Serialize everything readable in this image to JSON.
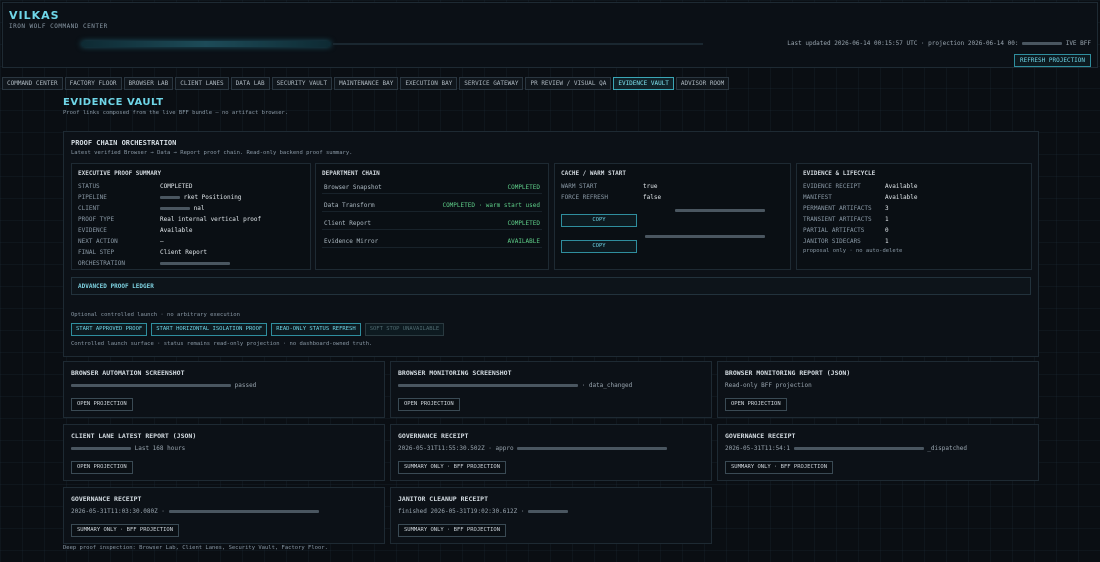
{
  "header": {
    "brand": "VILKAS",
    "subtitle": "IRON WOLF COMMAND CENTER",
    "updated": "Last updated 2026-06-14 00:15:57 UTC · projection 2026-06-14 00:",
    "updated_suffix": "IVE BFF",
    "refresh_label": "REFRESH PROJECTION"
  },
  "tabs": [
    {
      "label": "COMMAND CENTER",
      "active": false
    },
    {
      "label": "FACTORY FLOOR",
      "active": false
    },
    {
      "label": "BROWSER LAB",
      "active": false
    },
    {
      "label": "CLIENT LANES",
      "active": false
    },
    {
      "label": "DATA LAB",
      "active": false
    },
    {
      "label": "SECURITY VAULT",
      "active": false
    },
    {
      "label": "MAINTENANCE BAY",
      "active": false
    },
    {
      "label": "EXECUTION BAY",
      "active": false
    },
    {
      "label": "SERVICE GATEWAY",
      "active": false
    },
    {
      "label": "PR REVIEW / VISUAL QA",
      "active": false
    },
    {
      "label": "EVIDENCE VAULT",
      "active": true
    },
    {
      "label": "ADVISOR ROOM",
      "active": false
    }
  ],
  "page": {
    "title": "EVIDENCE VAULT",
    "description": "Proof links composed from the live BFF bundle — no artifact browser."
  },
  "orchestration": {
    "title": "PROOF CHAIN ORCHESTRATION",
    "description": "Latest verified Browser → Data → Report proof chain. Read-only backend proof summary.",
    "executive": {
      "title": "EXECUTIVE PROOF SUMMARY",
      "rows": [
        {
          "k": "STATUS",
          "v": "COMPLETED"
        },
        {
          "k": "PIPELINE",
          "v": "rket Positioning"
        },
        {
          "k": "CLIENT",
          "v": "nal"
        },
        {
          "k": "PROOF TYPE",
          "v": "Real internal vertical proof"
        },
        {
          "k": "EVIDENCE",
          "v": "Available"
        },
        {
          "k": "NEXT ACTION",
          "v": "—"
        },
        {
          "k": "FINAL STEP",
          "v": "Client Report"
        },
        {
          "k": "ORCHESTRATION",
          "v": ""
        }
      ]
    },
    "department": {
      "title": "DEPARTMENT CHAIN",
      "rows": [
        {
          "n": "Browser Snapshot",
          "s": "COMPLETED"
        },
        {
          "n": "Data Transform",
          "s": "COMPLETED · warm start used"
        },
        {
          "n": "Client Report",
          "s": "COMPLETED"
        },
        {
          "n": "Evidence Mirror",
          "s": "AVAILABLE"
        }
      ]
    },
    "cache": {
      "title": "CACHE / WARM START",
      "rows": [
        {
          "k": "WARM START",
          "v": "true"
        },
        {
          "k": "FORCE REFRESH",
          "v": "false"
        }
      ],
      "copy_label": "COPY"
    },
    "lifecycle": {
      "title": "EVIDENCE & LIFECYCLE",
      "rows": [
        {
          "k": "EVIDENCE RECEIPT",
          "v": "Available"
        },
        {
          "k": "MANIFEST",
          "v": "Available"
        },
        {
          "k": "PERMANENT ARTIFACTS",
          "v": "3"
        },
        {
          "k": "TRANSIENT ARTIFACTS",
          "v": "1"
        },
        {
          "k": "PARTIAL ARTIFACTS",
          "v": "0"
        },
        {
          "k": "JANITOR SIDECARS",
          "v": "1"
        }
      ],
      "note": "proposal only · no auto-delete"
    },
    "ledger_label": "ADVANCED PROOF LEDGER",
    "optional_note": "Optional controlled launch · no arbitrary execution",
    "actions": [
      {
        "label": "START APPROVED PROOF",
        "disabled": false
      },
      {
        "label": "START HORIZONTAL ISOLATION PROOF",
        "disabled": false
      },
      {
        "label": "READ-ONLY STATUS REFRESH",
        "disabled": false
      },
      {
        "label": "SOFT STOP UNAVAILABLE",
        "disabled": true
      }
    ],
    "control_note": "Controlled launch surface · status remains read-only projection · no dashboard-owned truth."
  },
  "artifacts": [
    {
      "title": "BROWSER AUTOMATION SCREENSHOT",
      "desc": "passed",
      "button": "OPEN PROJECTION"
    },
    {
      "title": "BROWSER MONITORING SCREENSHOT",
      "desc": "· data_changed",
      "button": "OPEN PROJECTION"
    },
    {
      "title": "BROWSER MONITORING REPORT (JSON)",
      "desc": "Read-only BFF projection",
      "button": "OPEN PROJECTION"
    },
    {
      "title": "CLIENT LANE LATEST REPORT (JSON)",
      "desc": "Last 168 hours",
      "button": "OPEN PROJECTION"
    },
    {
      "title": "GOVERNANCE RECEIPT",
      "desc": "2026-05-31T11:55:30.502Z · appro",
      "button": "SUMMARY ONLY · BFF PROJECTION"
    },
    {
      "title": "GOVERNANCE RECEIPT",
      "desc": "2026-05-31T11:54:1",
      "desc2": "_dispatched",
      "button": "SUMMARY ONLY · BFF PROJECTION"
    },
    {
      "title": "GOVERNANCE RECEIPT",
      "desc": "2026-05-31T11:03:30.080Z ·",
      "button": "SUMMARY ONLY · BFF PROJECTION"
    },
    {
      "title": "JANITOR CLEANUP RECEIPT",
      "desc": "finished 2026-05-31T19:02:30.612Z ·",
      "button": "SUMMARY ONLY · BFF PROJECTION"
    }
  ],
  "footnote": "Deep proof inspection: Browser Lab, Client Lanes, Security Vault, Factory Floor."
}
